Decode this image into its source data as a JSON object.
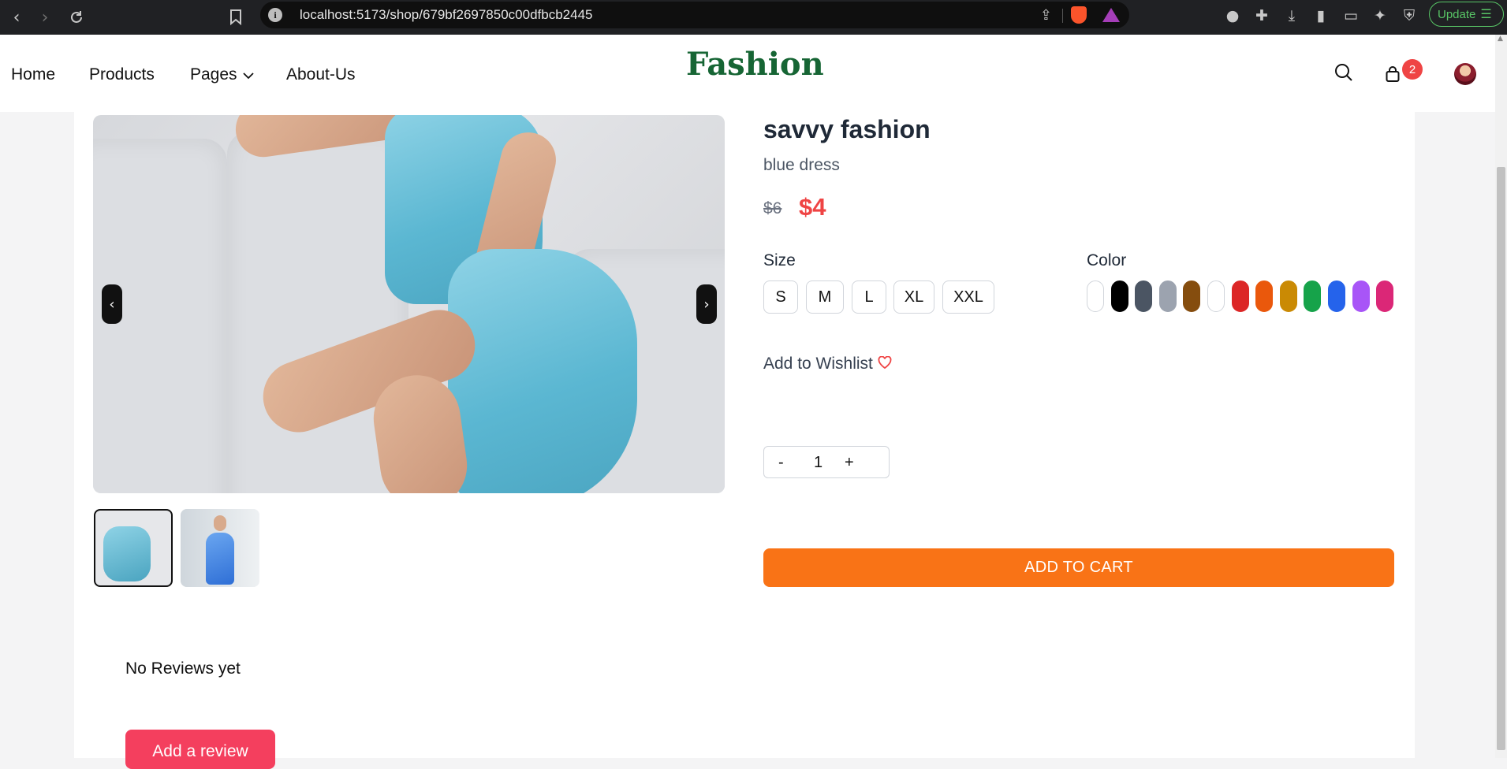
{
  "browser": {
    "url": "localhost:5173/shop/679bf2697850c00dfbcb2445",
    "update_label": "Update",
    "update_color": "#58c566"
  },
  "header": {
    "nav": [
      "Home",
      "Products",
      "Pages",
      "About-Us"
    ],
    "brand": "Fashion",
    "brand_color": "#166534",
    "cart_count": "2"
  },
  "product": {
    "title": "savvy fashion",
    "subtitle": "blue dress",
    "old_price": "$6",
    "new_price": "$4",
    "size_label": "Size",
    "sizes": [
      "S",
      "M",
      "L",
      "XL",
      "XXL"
    ],
    "color_label": "Color",
    "colors": [
      "#ffffff",
      "#000000",
      "#4b5563",
      "#9ca3af",
      "#854d0e",
      "#ffffff",
      "#dc2626",
      "#ea580c",
      "#ca8a04",
      "#16a34a",
      "#2563eb",
      "#a855f7",
      "#db2777"
    ],
    "wishlist_label": "Add to Wishlist",
    "qty_minus": "-",
    "qty_value": "1",
    "qty_plus": "+",
    "add_to_cart": "ADD TO CART",
    "accent_color": "#f97316"
  },
  "gallery": {
    "prev": "‹",
    "next": "›",
    "thumbnail_count": 2,
    "active_thumbnail": 1
  },
  "reviews": {
    "empty_text": "No Reviews yet",
    "add_label": "Add a review",
    "button_color": "#f43f5e"
  }
}
